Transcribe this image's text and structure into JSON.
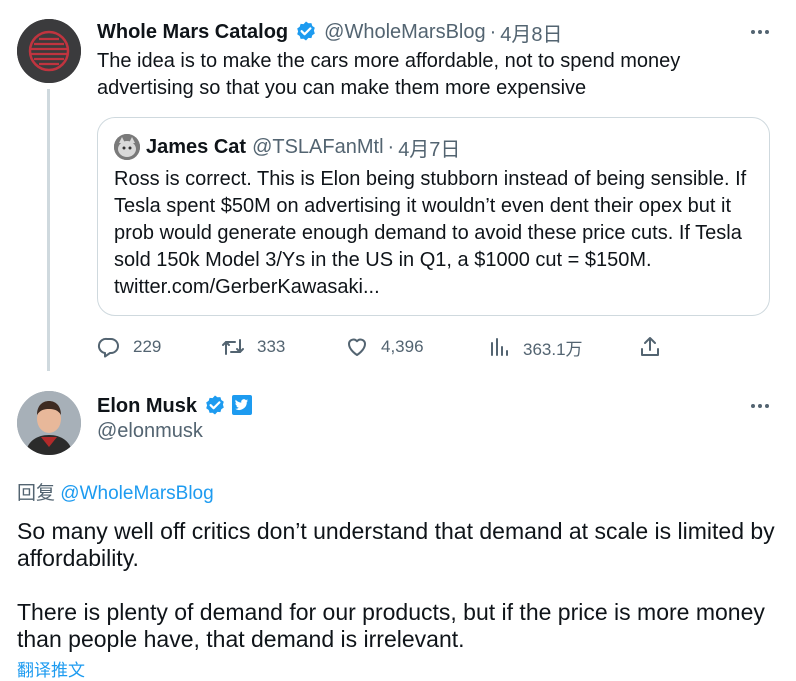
{
  "parent_tweet": {
    "author_name": "Whole Mars Catalog",
    "handle": "@WholeMarsBlog",
    "separator": "·",
    "date": "4月8日",
    "text": "The idea is to make the cars more affordable, not to spend money advertising so that you can make them more expensive",
    "quote": {
      "author_name": "James Cat",
      "handle": "@TSLAFanMtl",
      "separator": "·",
      "date": "4月7日",
      "text": "Ross is correct. This is Elon being stubborn instead of being sensible. If Tesla spent $50M on advertising it wouldn’t even dent their opex but it prob would generate enough demand to avoid these price cuts. If Tesla sold 150k Model 3/Ys in the US in Q1, a $1000 cut = $150M. twitter.com/GerberKawasaki..."
    },
    "stats": {
      "replies": "229",
      "retweets": "333",
      "likes": "4,396",
      "views": "363.1万"
    }
  },
  "main_tweet": {
    "author_name": "Elon Musk",
    "handle": "@elonmusk",
    "reply_prefix": "回复",
    "reply_to": "@WholeMarsBlog",
    "paragraphs": [
      "So many well off critics don’t understand that demand at scale is limited by affordability.",
      "There is plenty of demand for our products, but if the price is more money than people have, that demand is irrelevant."
    ],
    "translate_label": "翻译推文"
  },
  "icons": {
    "verified": "verified-badge-icon",
    "affiliate": "twitter-affiliate-icon",
    "reply": "reply-icon",
    "retweet": "retweet-icon",
    "like": "heart-icon",
    "views": "views-chart-icon",
    "share": "share-icon",
    "more": "more-icon"
  },
  "colors": {
    "accent": "#1d9bf0",
    "text": "#0f1419",
    "secondary": "#536471",
    "border": "#cfd9de"
  }
}
